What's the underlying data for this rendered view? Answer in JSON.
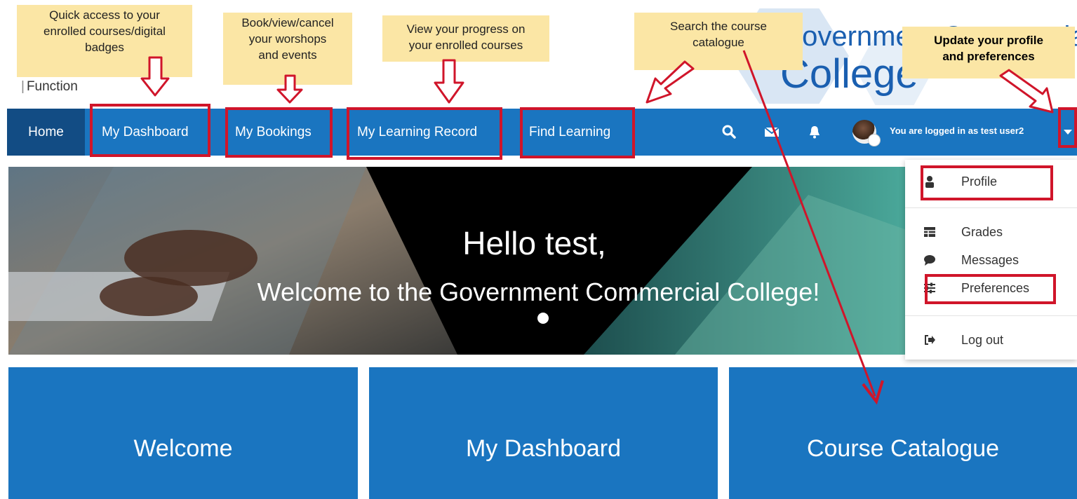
{
  "header": {
    "function_text": "Function",
    "logo_line1": "Government Commercial",
    "logo_line2": "College"
  },
  "callouts": [
    {
      "id": "dashboard",
      "lines": [
        "Quick access to your",
        "enrolled courses/digital",
        "badges"
      ]
    },
    {
      "id": "bookings",
      "lines": [
        "Book/view/cancel",
        "your worshops",
        "and events"
      ]
    },
    {
      "id": "learning_record",
      "lines": [
        "View your progress on",
        "your enrolled courses"
      ]
    },
    {
      "id": "find_learning",
      "lines": [
        "Search the course",
        "catalogue"
      ]
    },
    {
      "id": "profile",
      "lines": [
        "Update  your profile",
        "and preferences"
      ]
    }
  ],
  "navbar": {
    "home": "Home",
    "items": [
      "My Dashboard",
      "My Bookings",
      "My Learning Record",
      "Find Learning"
    ],
    "icons": [
      "search-icon",
      "envelope-icon",
      "bell-icon"
    ],
    "user_status": "You are logged in as test user2"
  },
  "hero": {
    "greeting": "Hello test,",
    "welcome": "Welcome to the Government Commercial College!"
  },
  "user_menu": {
    "items": [
      {
        "label": "Profile",
        "icon": "user-icon"
      },
      {
        "label": "Grades",
        "icon": "table-icon"
      },
      {
        "label": "Messages",
        "icon": "chat-bubble-icon"
      },
      {
        "label": "Preferences",
        "icon": "sliders-icon"
      },
      {
        "label": "Log out",
        "icon": "logout-icon"
      }
    ]
  },
  "tiles": [
    "Welcome",
    "My Dashboard",
    "Course Catalogue"
  ],
  "colors": {
    "nav_blue": "#1a75c0",
    "nav_dark": "#124c84",
    "callout_yellow": "#fbe6a5",
    "annotation_red": "#d0152a",
    "logo_blue": "#1a5fb0"
  }
}
